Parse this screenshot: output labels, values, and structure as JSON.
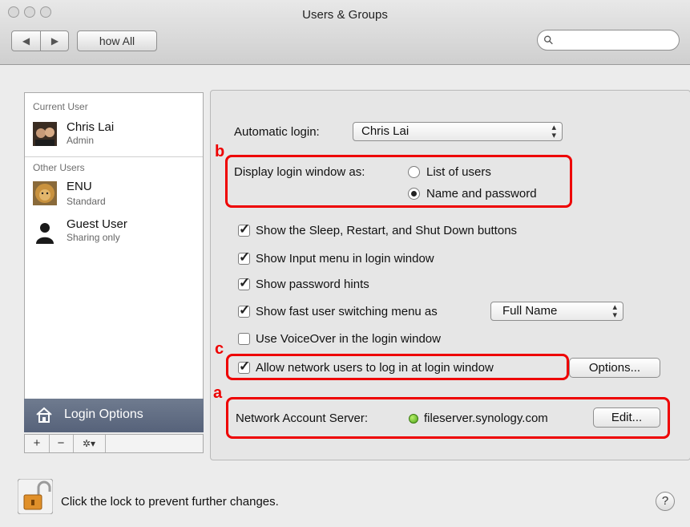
{
  "window": {
    "title": "Users & Groups"
  },
  "toolbar": {
    "back": "◀",
    "forward": "▶",
    "show_all": "how All",
    "search_placeholder": ""
  },
  "sidebar": {
    "current_user_header": "Current User",
    "current_user": {
      "name": "Chris Lai",
      "role": "Admin"
    },
    "other_users_header": "Other Users",
    "other_users": [
      {
        "name": "ENU",
        "role": "Standard"
      },
      {
        "name": "Guest User",
        "role": "Sharing only"
      }
    ],
    "login_options": "Login Options",
    "add": "+",
    "remove": "−",
    "action": "✲▾"
  },
  "login": {
    "automatic_login_label": "Automatic login:",
    "automatic_login_value": "Chris Lai",
    "display_as_label": "Display login window as:",
    "display_options": [
      "List of users",
      "Name and password"
    ],
    "display_selected": "Name and password",
    "checkboxes": [
      {
        "label": "Show the Sleep, Restart, and Shut Down buttons",
        "checked": true
      },
      {
        "label": "Show Input menu in login window",
        "checked": true
      },
      {
        "label": "Show password hints",
        "checked": true
      },
      {
        "label": "Show fast user switching menu as",
        "checked": true
      },
      {
        "label": "Use VoiceOver in the login window",
        "checked": false
      },
      {
        "label": "Allow network users to log in at login window",
        "checked": true
      }
    ],
    "fast_switch_value": "Full Name",
    "options_button": "Options...",
    "network_server_label": "Network Account Server:",
    "network_server_value": "fileserver.synology.com",
    "edit_button": "Edit..."
  },
  "annotations": {
    "a": "a",
    "b": "b",
    "c": "c",
    "color": "#ee0000"
  },
  "footer": {
    "lock_text": "Click the lock to prevent further changes.",
    "help": "?"
  }
}
